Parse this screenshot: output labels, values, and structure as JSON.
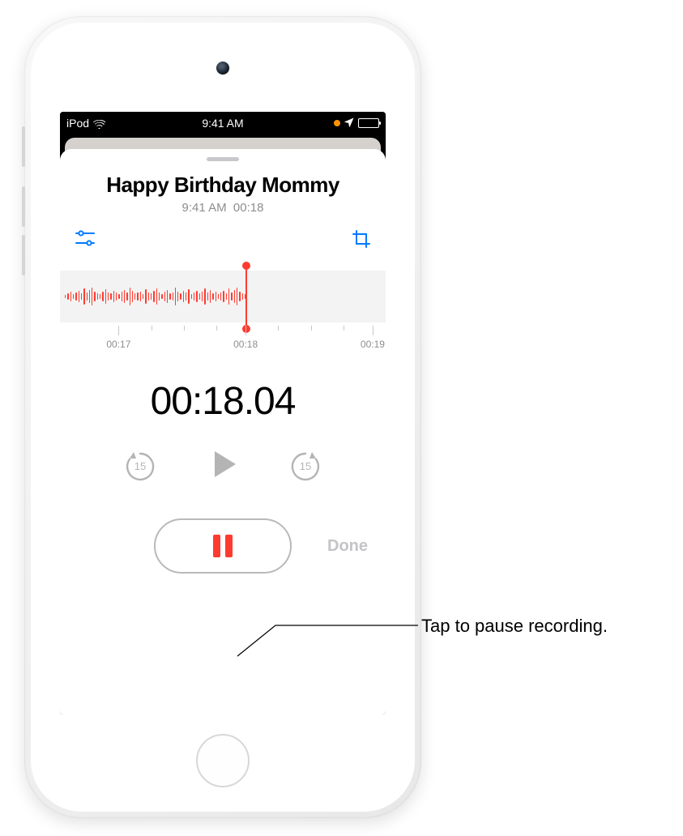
{
  "status": {
    "device": "iPod",
    "time": "9:41 AM"
  },
  "recording": {
    "title": "Happy Birthday Mommy",
    "time": "9:41 AM",
    "duration": "00:18",
    "elapsed": "00:18.04"
  },
  "ticks": {
    "t1": "00:17",
    "t2": "00:18",
    "t3": "00:19"
  },
  "controls": {
    "skip_back": "15",
    "skip_forward": "15",
    "done": "Done"
  },
  "callout": {
    "pause": "Tap to pause recording."
  },
  "waveform": [
    4,
    8,
    12,
    6,
    10,
    14,
    8,
    20,
    10,
    16,
    22,
    12,
    8,
    6,
    12,
    18,
    10,
    8,
    14,
    10,
    6,
    12,
    16,
    10,
    22,
    14,
    8,
    10,
    12,
    6,
    18,
    10,
    8,
    14,
    20,
    10,
    6,
    12,
    16,
    8,
    10,
    22,
    12,
    8,
    14,
    10,
    18,
    6,
    10,
    14,
    8,
    12,
    20,
    10,
    16,
    8,
    12,
    6,
    10,
    14,
    8,
    20,
    10,
    16,
    22,
    12,
    8,
    6
  ]
}
